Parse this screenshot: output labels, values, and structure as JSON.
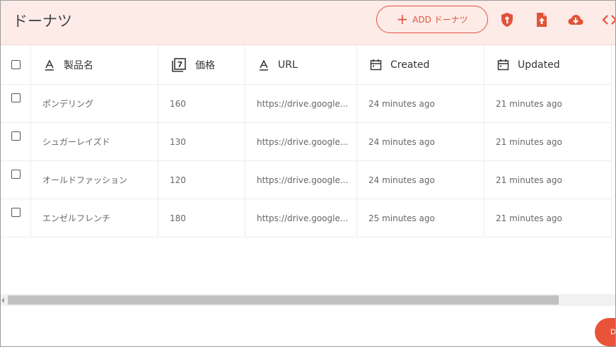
{
  "header": {
    "title": "ドーナツ",
    "add_button_label": "ADD ドーナツ",
    "icons": [
      "key-shield-icon",
      "file-upload-icon",
      "cloud-download-icon",
      "code-icon"
    ]
  },
  "colors": {
    "accent": "#e0533a",
    "header_bg": "#fdebe8"
  },
  "table": {
    "columns": [
      {
        "label": "製品名",
        "icon": "text-type-icon"
      },
      {
        "label": "価格",
        "icon": "number-type-icon",
        "icon_glyph": "7"
      },
      {
        "label": "URL",
        "icon": "text-type-icon"
      },
      {
        "label": "Created",
        "icon": "calendar-icon"
      },
      {
        "label": "Updated",
        "icon": "calendar-icon"
      }
    ],
    "rows": [
      {
        "name": "ポンデリング",
        "price": "160",
        "url": "https://drive.google...",
        "created": "24 minutes ago",
        "updated": "21 minutes ago"
      },
      {
        "name": "シュガーレイズド",
        "price": "130",
        "url": "https://drive.google...",
        "created": "24 minutes ago",
        "updated": "21 minutes ago"
      },
      {
        "name": "オールドファッション",
        "price": "120",
        "url": "https://drive.google...",
        "created": "24 minutes ago",
        "updated": "21 minutes ago"
      },
      {
        "name": "エンゼルフレンチ",
        "price": "180",
        "url": "https://drive.google...",
        "created": "25 minutes ago",
        "updated": "21 minutes ago"
      }
    ]
  },
  "fab": {
    "label": "D"
  }
}
